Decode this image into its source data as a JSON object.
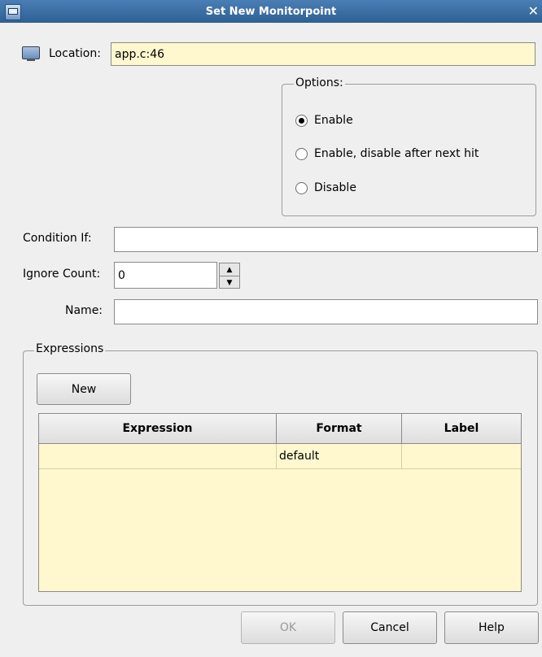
{
  "window": {
    "title": "Set New Monitorpoint",
    "close_glyph": "✕"
  },
  "location": {
    "label": "Location:",
    "value": "app.c:46"
  },
  "options": {
    "title": "Options:",
    "items": [
      {
        "label": "Enable",
        "selected": true
      },
      {
        "label": "Enable, disable after next hit",
        "selected": false
      },
      {
        "label": "Disable",
        "selected": false
      }
    ]
  },
  "condition": {
    "label": "Condition If:",
    "value": ""
  },
  "ignore_count": {
    "label": "Ignore Count:",
    "value": "0"
  },
  "name": {
    "label": "Name:",
    "value": ""
  },
  "expressions": {
    "title": "Expressions",
    "new_label": "New",
    "columns": [
      "Expression",
      "Format",
      "Label"
    ],
    "rows": [
      {
        "expression": "",
        "format": "default",
        "label": ""
      }
    ]
  },
  "buttons": {
    "ok": "OK",
    "cancel": "Cancel",
    "help": "Help"
  },
  "icons": {
    "window": "app-icon",
    "location": "monitor-icon",
    "spin_up": "arrow-up-icon",
    "spin_down": "arrow-down-icon"
  }
}
